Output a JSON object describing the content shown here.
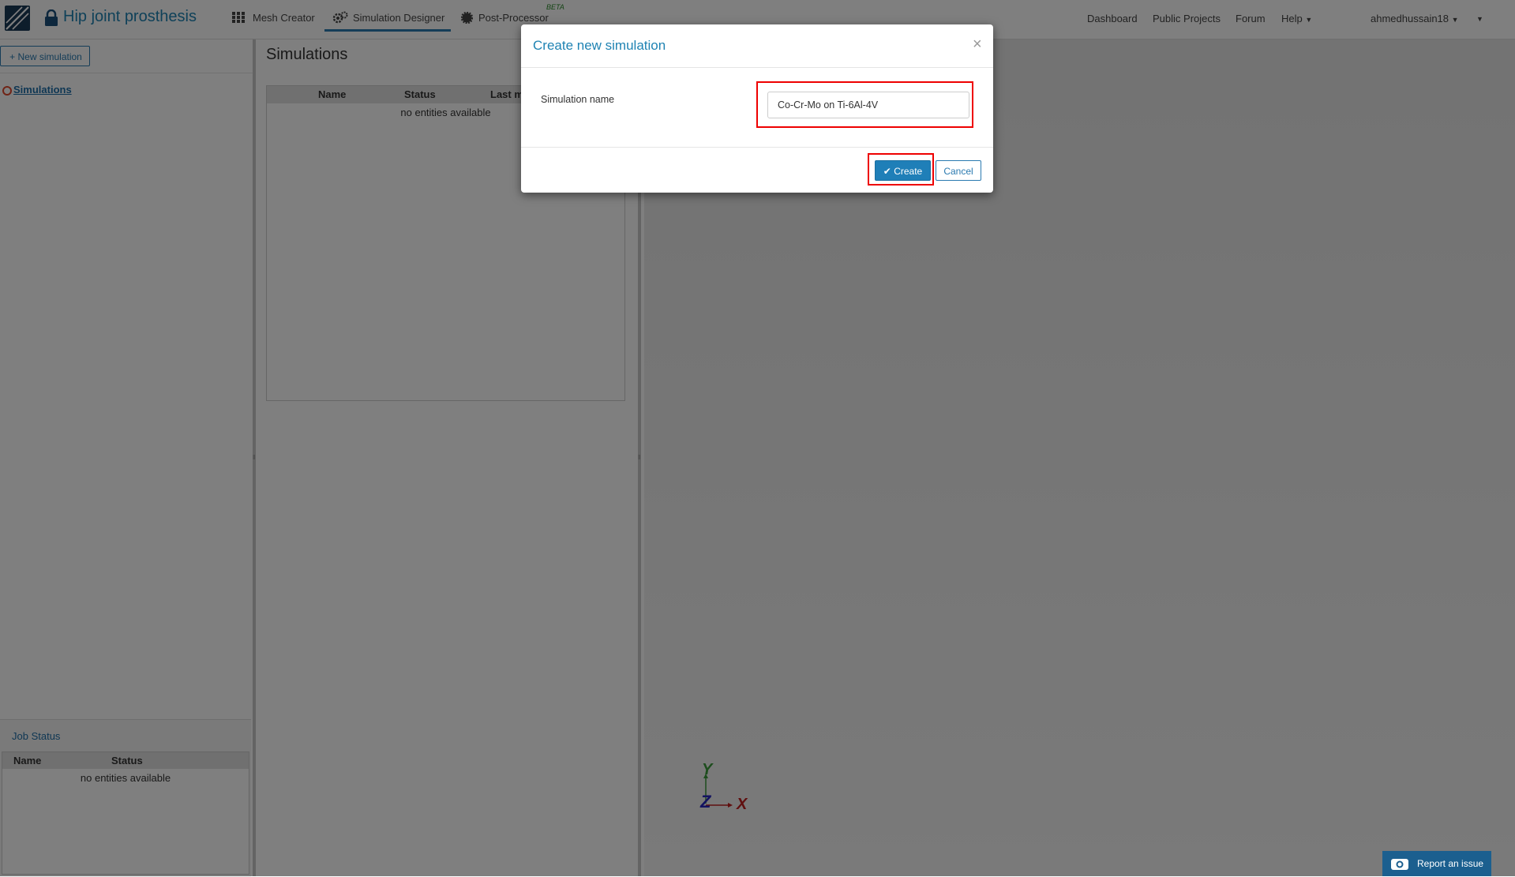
{
  "app": {
    "title": "Hip joint prosthesis",
    "tabs": [
      {
        "label": "Mesh Creator"
      },
      {
        "label": "Simulation Designer"
      },
      {
        "label": "Post-Processor"
      }
    ],
    "beta_badge": "BETA",
    "right_nav": [
      "Dashboard",
      "Public Projects",
      "Forum",
      "Help"
    ],
    "username": "ahmedhussain18"
  },
  "left": {
    "new_simulation": "New simulation",
    "tree_root": "Simulations",
    "job_status": {
      "title": "Job Status",
      "columns": [
        "Name",
        "Status"
      ],
      "empty": "no entities available"
    }
  },
  "middle": {
    "heading": "Simulations",
    "columns": [
      "Name",
      "Status",
      "Last m"
    ],
    "empty": "no entities available"
  },
  "axes": {
    "y": "Y",
    "z": "Z",
    "x": "X"
  },
  "modal": {
    "title": "Create new simulation",
    "close": "×",
    "field_label": "Simulation name",
    "field_value": "Co-Cr-Mo on Ti-6Al-4V",
    "create": "Create",
    "cancel": "Cancel"
  },
  "report_issue": "Report an issue"
}
